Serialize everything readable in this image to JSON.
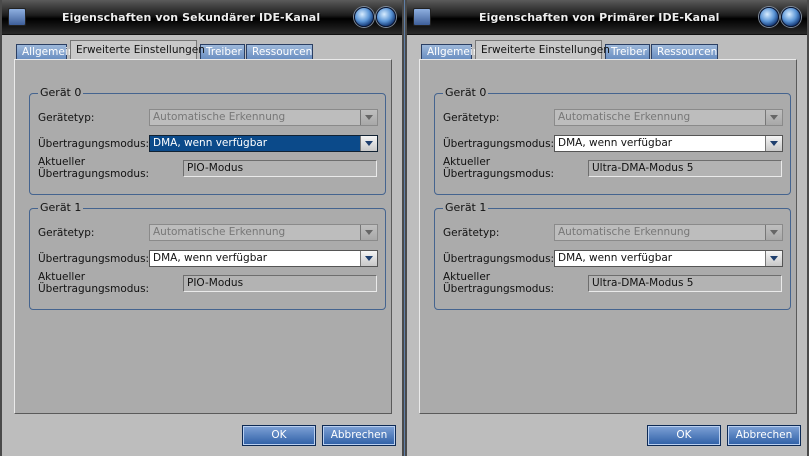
{
  "windows": [
    {
      "title": "Eigenschaften von Sekundärer IDE-Kanal",
      "tabs": [
        "Allgemein",
        "Erweiterte Einstellungen",
        "Treiber",
        "Ressourcen"
      ],
      "devices": [
        {
          "legend": "Gerät 0",
          "device_type_label": "Gerätetyp:",
          "device_type_value": "Automatische Erkennung",
          "transfer_mode_label": "Übertragungsmodus:",
          "transfer_mode_value": "DMA, wenn verfügbar",
          "current_mode_label_1": "Aktueller",
          "current_mode_label_2": "Übertragungsmodus:",
          "current_mode_value": "PIO-Modus"
        },
        {
          "legend": "Gerät 1",
          "device_type_label": "Gerätetyp:",
          "device_type_value": "Automatische Erkennung",
          "transfer_mode_label": "Übertragungsmodus:",
          "transfer_mode_value": "DMA, wenn verfügbar",
          "current_mode_label_1": "Aktueller",
          "current_mode_label_2": "Übertragungsmodus:",
          "current_mode_value": "PIO-Modus"
        }
      ],
      "ok_label": "OK",
      "cancel_label": "Abbrechen"
    },
    {
      "title": "Eigenschaften von Primärer IDE-Kanal",
      "tabs": [
        "Allgemein",
        "Erweiterte Einstellungen",
        "Treiber",
        "Ressourcen"
      ],
      "devices": [
        {
          "legend": "Gerät 0",
          "device_type_label": "Gerätetyp:",
          "device_type_value": "Automatische Erkennung",
          "transfer_mode_label": "Übertragungsmodus:",
          "transfer_mode_value": "DMA, wenn verfügbar",
          "current_mode_label_1": "Aktueller",
          "current_mode_label_2": "Übertragungsmodus:",
          "current_mode_value": "Ultra-DMA-Modus 5"
        },
        {
          "legend": "Gerät 1",
          "device_type_label": "Gerätetyp:",
          "device_type_value": "Automatische Erkennung",
          "transfer_mode_label": "Übertragungsmodus:",
          "transfer_mode_value": "DMA, wenn verfügbar",
          "current_mode_label_1": "Aktueller",
          "current_mode_label_2": "Übertragungsmodus:",
          "current_mode_value": "Ultra-DMA-Modus 5"
        }
      ],
      "ok_label": "OK",
      "cancel_label": "Abbrechen"
    }
  ]
}
